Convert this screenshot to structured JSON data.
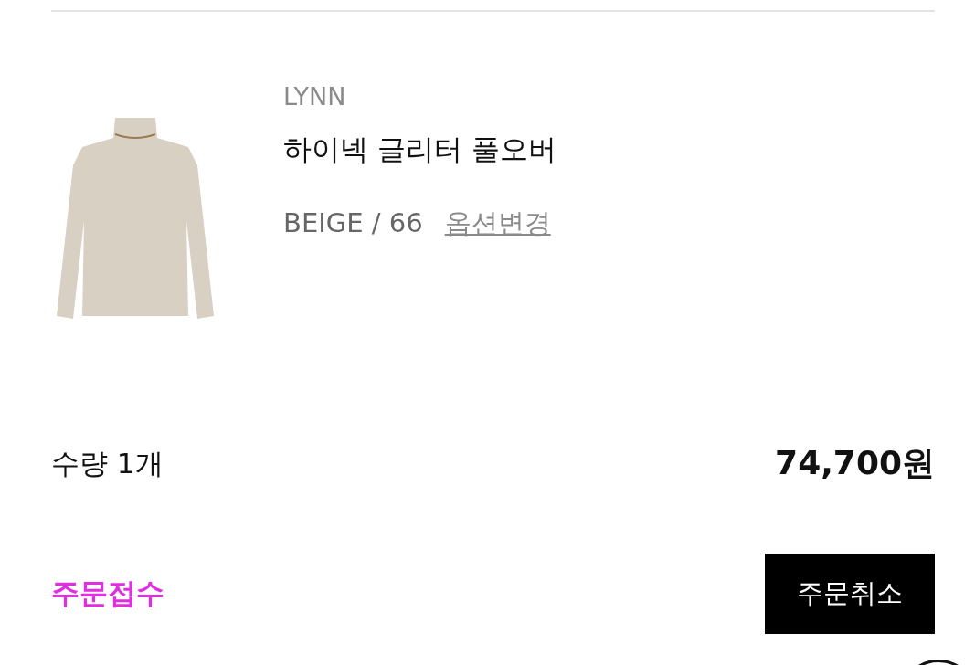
{
  "product": {
    "brand": "LYNN",
    "name": "하이넥 글리터 풀오버",
    "option": "BEIGE / 66",
    "option_link": "옵션변경"
  },
  "quantity": "수량 1개",
  "price": "74,700원",
  "status": "주문접수",
  "cancel_button": "주문취소"
}
